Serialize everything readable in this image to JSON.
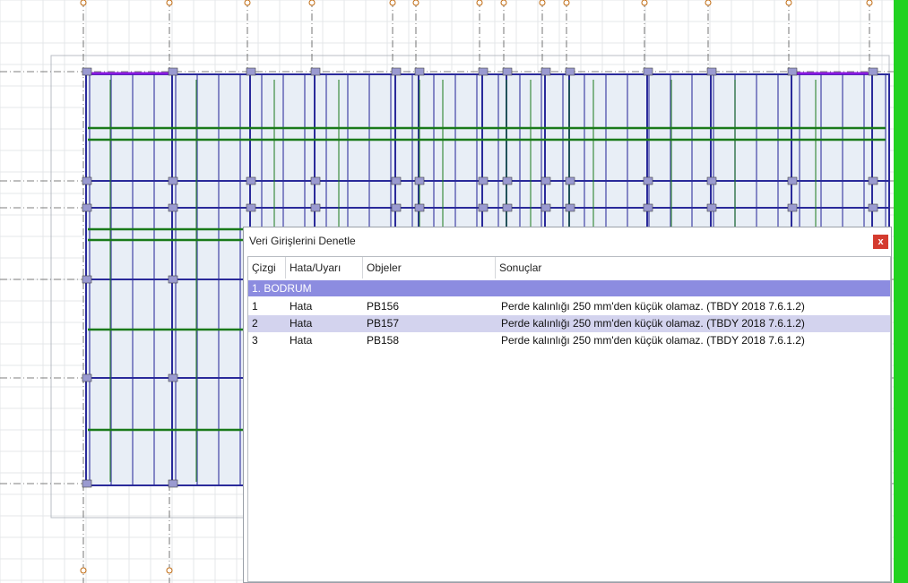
{
  "dialog": {
    "title": "Veri Girişlerini Denetle",
    "close_glyph": "x"
  },
  "table": {
    "columns": [
      "Çizgi",
      "Hata/Uyarı",
      "Objeler",
      "Sonuçlar"
    ],
    "group": "1. BODRUM",
    "rows": [
      {
        "cizgi": "1",
        "type": "Hata",
        "object": "PB156",
        "result": "Perde kalınlığı 250 mm'den küçük olamaz. (TBDY 2018 7.6.1.2)"
      },
      {
        "cizgi": "2",
        "type": "Hata",
        "object": "PB157",
        "result": "Perde kalınlığı 250 mm'den küçük olamaz. (TBDY 2018 7.6.1.2)"
      },
      {
        "cizgi": "3",
        "type": "Hata",
        "object": "PB158",
        "result": "Perde kalınlığı 250 mm'den küçük olamaz. (TBDY 2018 7.6.1.2)"
      }
    ],
    "selected_row": 1
  },
  "colors": {
    "group_row": "#8c8ce0",
    "selected_row": "#d3d3ee",
    "close_button": "#d43b2f",
    "beam": "#2a2a9a",
    "rebar": "#1a7a1a",
    "slab_fill": "#e8eef6",
    "green_bar": "#21d221"
  },
  "icons": [
    "close-icon"
  ]
}
